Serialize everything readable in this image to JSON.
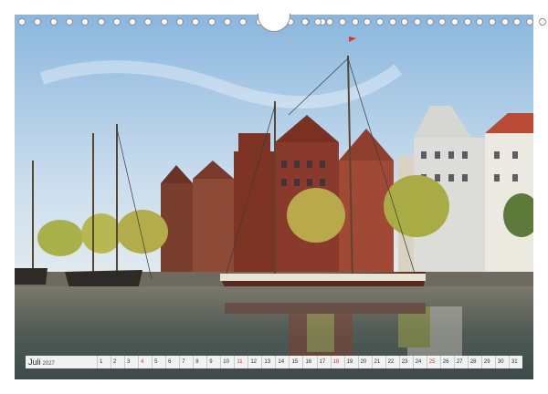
{
  "calendar": {
    "month": "Juli",
    "year": "2027",
    "days": [
      {
        "n": "1",
        "sunday": false
      },
      {
        "n": "2",
        "sunday": false
      },
      {
        "n": "3",
        "sunday": false
      },
      {
        "n": "4",
        "sunday": true
      },
      {
        "n": "5",
        "sunday": false
      },
      {
        "n": "6",
        "sunday": false
      },
      {
        "n": "7",
        "sunday": false
      },
      {
        "n": "8",
        "sunday": false
      },
      {
        "n": "9",
        "sunday": false
      },
      {
        "n": "10",
        "sunday": false
      },
      {
        "n": "11",
        "sunday": true
      },
      {
        "n": "12",
        "sunday": false
      },
      {
        "n": "13",
        "sunday": false
      },
      {
        "n": "14",
        "sunday": false
      },
      {
        "n": "15",
        "sunday": false
      },
      {
        "n": "16",
        "sunday": false
      },
      {
        "n": "17",
        "sunday": false
      },
      {
        "n": "18",
        "sunday": true
      },
      {
        "n": "19",
        "sunday": false
      },
      {
        "n": "20",
        "sunday": false
      },
      {
        "n": "21",
        "sunday": false
      },
      {
        "n": "22",
        "sunday": false
      },
      {
        "n": "23",
        "sunday": false
      },
      {
        "n": "24",
        "sunday": false
      },
      {
        "n": "25",
        "sunday": true
      },
      {
        "n": "26",
        "sunday": false
      },
      {
        "n": "27",
        "sunday": false
      },
      {
        "n": "28",
        "sunday": false
      },
      {
        "n": "29",
        "sunday": false
      },
      {
        "n": "30",
        "sunday": false
      },
      {
        "n": "31",
        "sunday": false
      }
    ]
  },
  "colors": {
    "sunday": "#d23a2a",
    "sky": "#8fb8dc",
    "water": "#4a5a52",
    "brick": "#8a3a2c"
  },
  "photo": {
    "subject": "harbour-with-sailing-ships-and-historic-gabled-houses"
  },
  "binding": {
    "hole_count_side": 20
  }
}
